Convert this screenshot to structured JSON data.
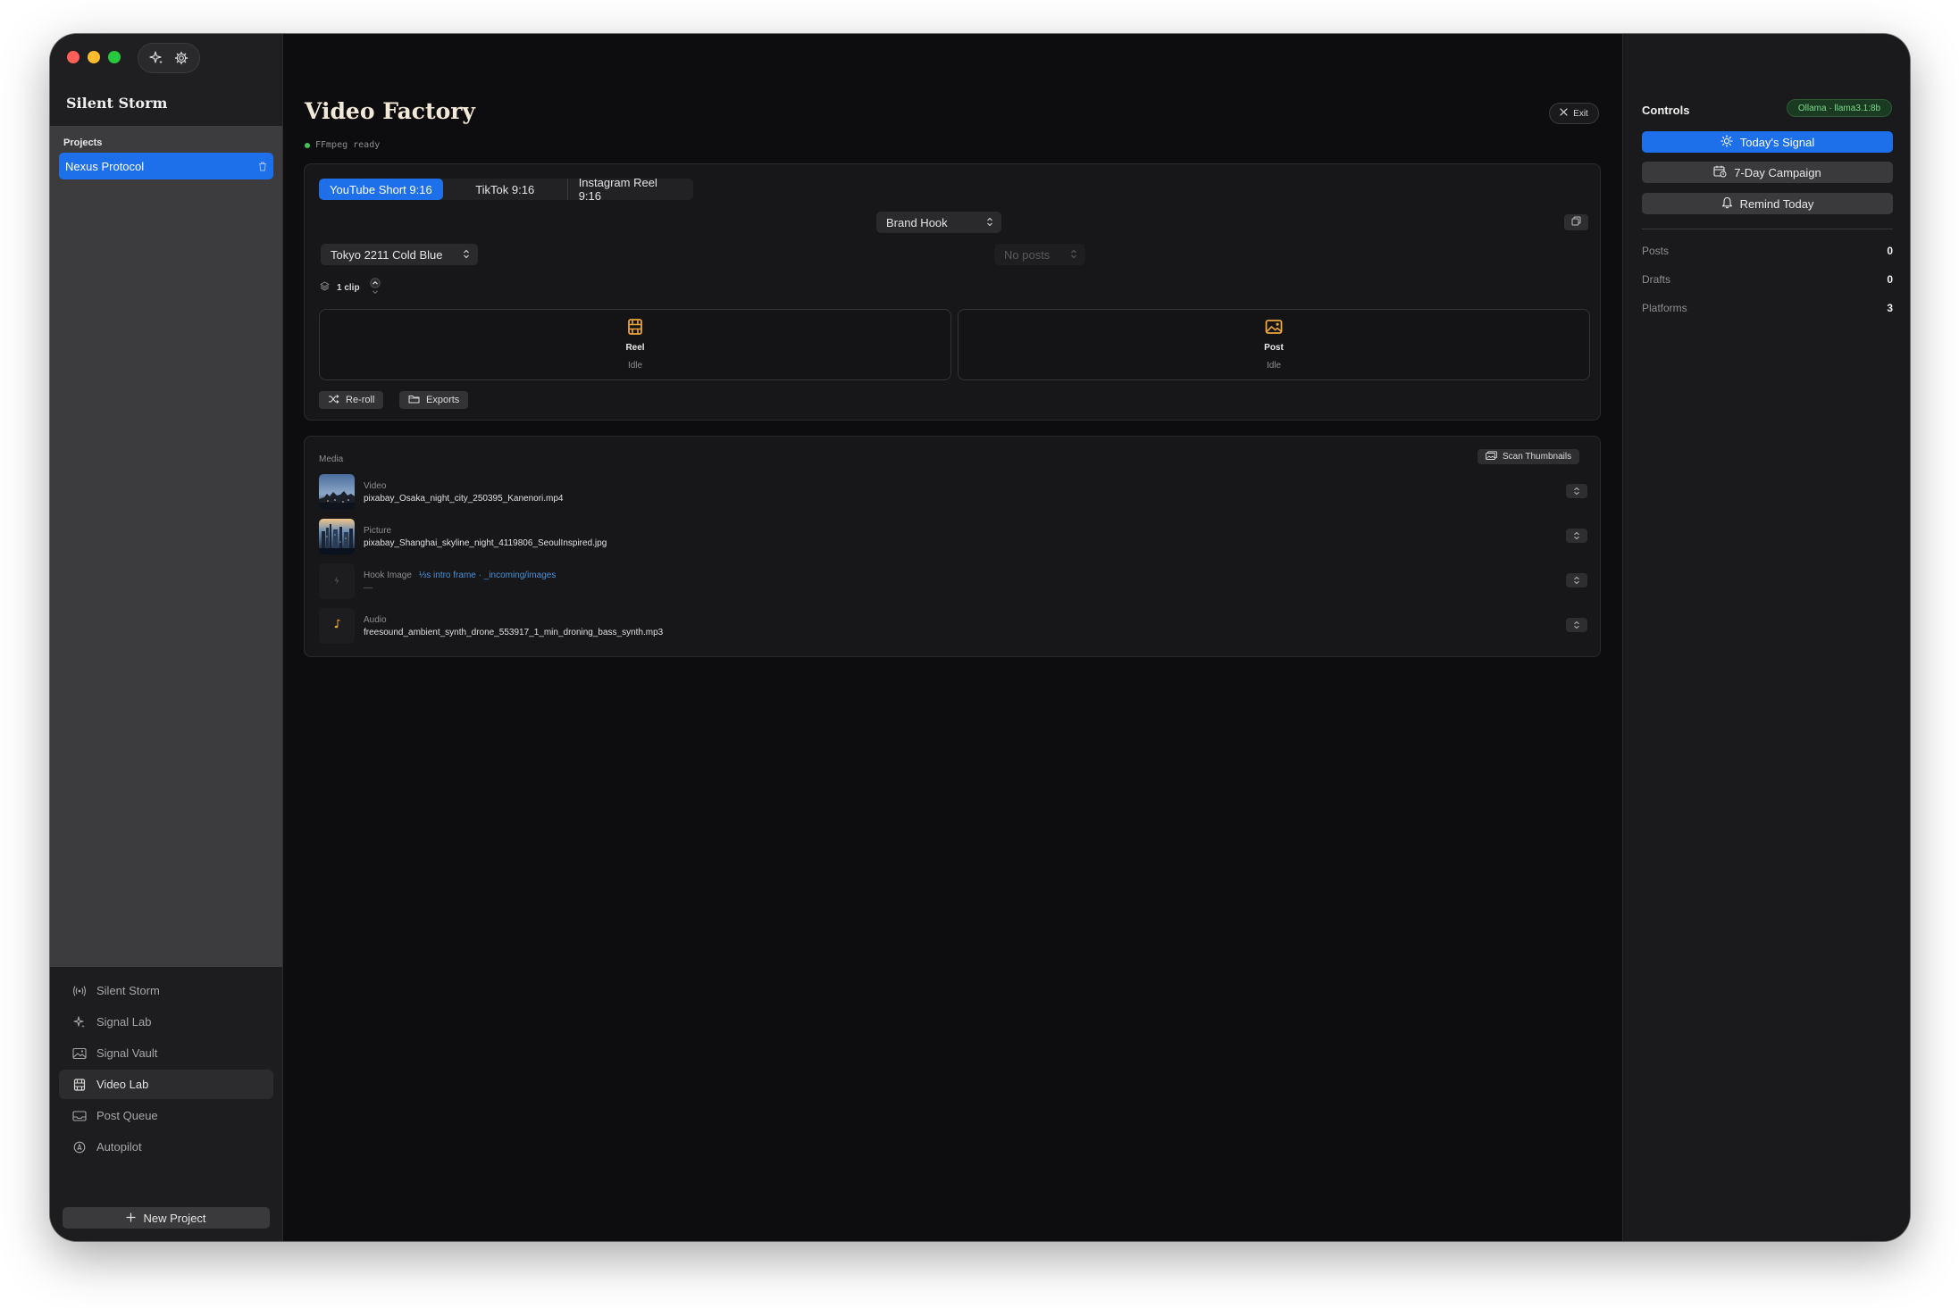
{
  "app": {
    "title": "Silent Storm"
  },
  "sidebar": {
    "projects_label": "Projects",
    "project": "Nexus Protocol",
    "nav": [
      {
        "label": "Silent Storm",
        "icon": "broadcast-icon"
      },
      {
        "label": "Signal Lab",
        "icon": "sparkle-icon"
      },
      {
        "label": "Signal Vault",
        "icon": "image-vault-icon"
      },
      {
        "label": "Video Lab",
        "icon": "film-icon",
        "active": true
      },
      {
        "label": "Post Queue",
        "icon": "tray-icon"
      },
      {
        "label": "Autopilot",
        "icon": "autopilot-icon"
      }
    ],
    "new_project": "New Project"
  },
  "main": {
    "title": "Video Factory",
    "status": "FFmpeg ready",
    "exit": "Exit",
    "formats": [
      "YouTube Short 9:16",
      "TikTok 9:16",
      "Instagram Reel 9:16"
    ],
    "active_format": 0,
    "hook_select": "Brand Hook",
    "preset_select": "Tokyo 2211 Cold Blue",
    "posts_select": "No posts",
    "clips": "1 clip",
    "cards": [
      {
        "title": "Reel",
        "status": "Idle",
        "icon": "film-icon"
      },
      {
        "title": "Post",
        "status": "Idle",
        "icon": "photo-icon"
      }
    ],
    "reroll": "Re-roll",
    "exports": "Exports",
    "media": {
      "label": "Media",
      "scan": "Scan Thumbnails",
      "rows": [
        {
          "kind": "Video",
          "file": "pixabay_Osaka_night_city_250395_Kanenori.mp4"
        },
        {
          "kind": "Picture",
          "file": "pixabay_Shanghai_skyline_night_4119806_SeoulInspired.jpg"
        },
        {
          "kind": "Hook Image",
          "hint": "⅓s intro frame · _incoming/images",
          "file": "—"
        },
        {
          "kind": "Audio",
          "file": "freesound_ambient_synth_drone_553917_1_min_droning_bass_synth.mp3"
        }
      ]
    }
  },
  "controls": {
    "title": "Controls",
    "model": "Ollama · llama3.1:8b",
    "buttons": [
      "Today's Signal",
      "7-Day Campaign",
      "Remind Today"
    ],
    "stats": [
      {
        "label": "Posts",
        "value": "0"
      },
      {
        "label": "Drafts",
        "value": "0"
      },
      {
        "label": "Platforms",
        "value": "3"
      }
    ]
  },
  "colors": {
    "accent": "#1e6fea",
    "status_ok": "#3ec45a",
    "model_badge": "#7cd98b",
    "card_icon": "#e8a33d",
    "hint": "#4a90d9"
  }
}
